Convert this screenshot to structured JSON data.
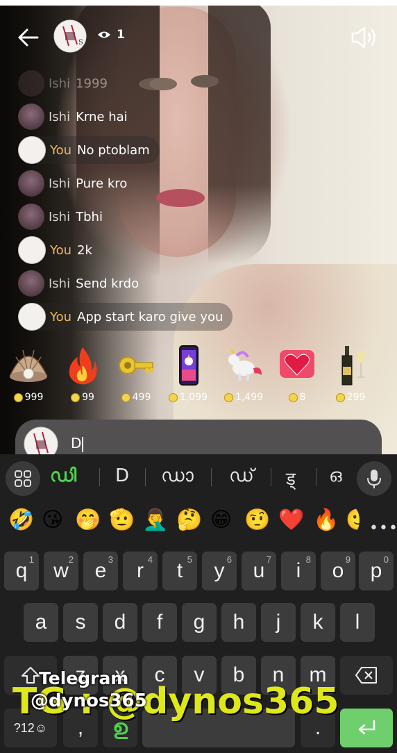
{
  "header": {
    "viewer_count": "1"
  },
  "chat": [
    {
      "name": "Ishi",
      "text": "1999",
      "sender": "her",
      "faded": true
    },
    {
      "name": "Ishi",
      "text": "Krne hai",
      "sender": "her"
    },
    {
      "name": "You",
      "text": "No ptoblam",
      "sender": "you"
    },
    {
      "name": "Ishi",
      "text": "Pure kro",
      "sender": "her"
    },
    {
      "name": "Ishi",
      "text": "Tbhi",
      "sender": "her"
    },
    {
      "name": "You",
      "text": "2k",
      "sender": "you"
    },
    {
      "name": "Ishi",
      "text": "Send krdo",
      "sender": "her"
    },
    {
      "name": "You",
      "text": "App start karo give you",
      "sender": "you"
    }
  ],
  "gifts": [
    {
      "icon": "pearl-shell-icon",
      "price": "999"
    },
    {
      "icon": "fire-icon",
      "price": "99"
    },
    {
      "icon": "key-icon",
      "price": "499"
    },
    {
      "icon": "phone-unicorn-icon",
      "price": "1,099"
    },
    {
      "icon": "flying-unicorn-icon",
      "price": "1,499"
    },
    {
      "icon": "heart-icon",
      "price": "8"
    },
    {
      "icon": "champagne-icon",
      "price": "299"
    }
  ],
  "input": {
    "value": "D"
  },
  "keyboard": {
    "suggestions": [
      "ഡി",
      "D",
      "ഡാ",
      "ഡ്",
      "ड्",
      "ഒ"
    ],
    "emojis": [
      "🤣",
      "😘",
      "🤭",
      "🫡",
      "🤦‍♂️",
      "🤔",
      "😁",
      "🤨",
      "❤️",
      "🔥",
      "🙂"
    ],
    "row1": [
      [
        "q",
        "1"
      ],
      [
        "w",
        "2"
      ],
      [
        "e",
        "3"
      ],
      [
        "r",
        "4"
      ],
      [
        "t",
        "5"
      ],
      [
        "y",
        "6"
      ],
      [
        "u",
        "7"
      ],
      [
        "i",
        "8"
      ],
      [
        "o",
        "9"
      ],
      [
        "p",
        "0"
      ]
    ],
    "row2": [
      "a",
      "s",
      "d",
      "f",
      "g",
      "h",
      "j",
      "k",
      "l"
    ],
    "row3": [
      "z",
      "x",
      "c",
      "v",
      "b",
      "n",
      "m"
    ],
    "symbols_label": "?12☺",
    "comma": ",",
    "period": ".",
    "lang_glyph": "ഉ"
  },
  "watermark": {
    "line1": "Telegram",
    "line2": "@dynos365",
    "big": "TG : @dynos365"
  },
  "colors": {
    "you_name": "#f2b85a",
    "suggest_active": "#4fd04f",
    "enter_key": "#6fcf6c",
    "watermark": "#e8f21a"
  }
}
